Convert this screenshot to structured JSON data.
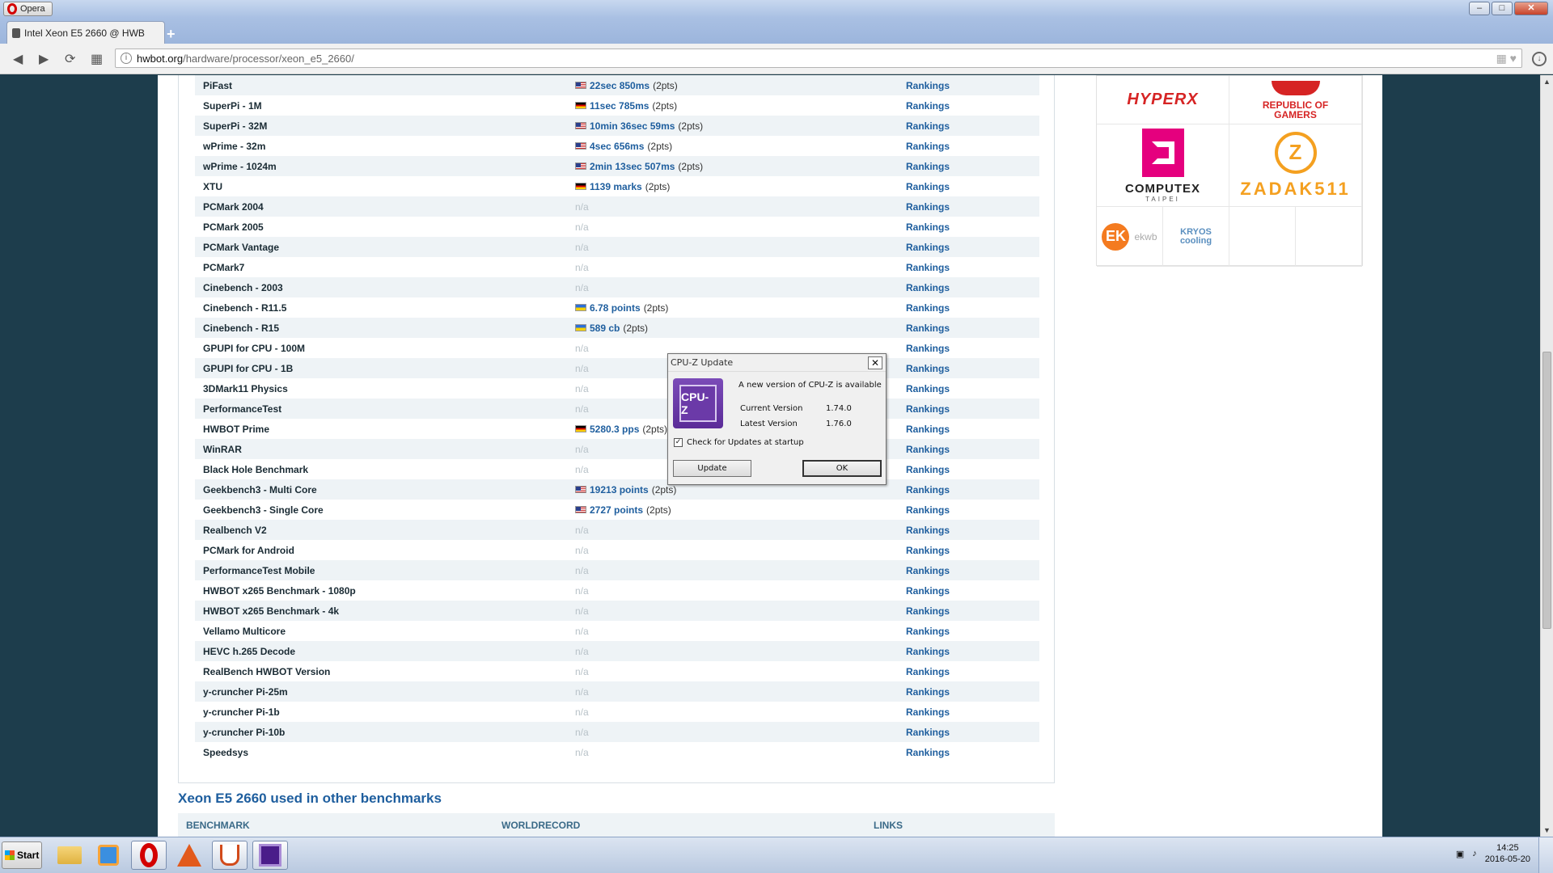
{
  "window": {
    "app_menu_label": "Opera",
    "minimize": "–",
    "maximize": "□",
    "close": "✕"
  },
  "tab": {
    "title": "Intel Xeon E5 2660 @ HWB",
    "new_tab": "+"
  },
  "address_bar": {
    "url_host": "hwbot.org",
    "url_path": "/hardware/processor/xeon_e5_2660/"
  },
  "benchmarks": [
    {
      "name": "PiFast",
      "flag": "us",
      "value": "22sec 850ms",
      "pts": "(2pts)",
      "link": "Rankings"
    },
    {
      "name": "SuperPi - 1M",
      "flag": "de",
      "value": "11sec 785ms",
      "pts": "(2pts)",
      "link": "Rankings"
    },
    {
      "name": "SuperPi - 32M",
      "flag": "us",
      "value": "10min 36sec 59ms",
      "pts": "(2pts)",
      "link": "Rankings"
    },
    {
      "name": "wPrime - 32m",
      "flag": "us",
      "value": "4sec 656ms",
      "pts": "(2pts)",
      "link": "Rankings"
    },
    {
      "name": "wPrime - 1024m",
      "flag": "us",
      "value": "2min 13sec 507ms",
      "pts": "(2pts)",
      "link": "Rankings"
    },
    {
      "name": "XTU",
      "flag": "de",
      "value": "1139 marks",
      "pts": "(2pts)",
      "link": "Rankings"
    },
    {
      "name": "PCMark 2004",
      "na": "n/a",
      "link": "Rankings"
    },
    {
      "name": "PCMark 2005",
      "na": "n/a",
      "link": "Rankings"
    },
    {
      "name": "PCMark Vantage",
      "na": "n/a",
      "link": "Rankings"
    },
    {
      "name": "PCMark7",
      "na": "n/a",
      "link": "Rankings"
    },
    {
      "name": "Cinebench - 2003",
      "na": "n/a",
      "link": "Rankings"
    },
    {
      "name": "Cinebench - R11.5",
      "flag": "ua",
      "value": "6.78 points",
      "pts": "(2pts)",
      "link": "Rankings"
    },
    {
      "name": "Cinebench - R15",
      "flag": "ua",
      "value": "589 cb",
      "pts": "(2pts)",
      "link": "Rankings"
    },
    {
      "name": "GPUPI for CPU - 100M",
      "na": "n/a",
      "link": "Rankings"
    },
    {
      "name": "GPUPI for CPU - 1B",
      "na": "n/a",
      "link": "Rankings"
    },
    {
      "name": "3DMark11 Physics",
      "na": "n/a",
      "link": "Rankings"
    },
    {
      "name": "PerformanceTest",
      "na": "n/a",
      "link": "Rankings"
    },
    {
      "name": "HWBOT Prime",
      "flag": "de",
      "value": "5280.3 pps",
      "pts": "(2pts)",
      "link": "Rankings"
    },
    {
      "name": "WinRAR",
      "na": "n/a",
      "link": "Rankings"
    },
    {
      "name": "Black Hole Benchmark",
      "na": "n/a",
      "link": "Rankings"
    },
    {
      "name": "Geekbench3 - Multi Core",
      "flag": "us",
      "value": "19213 points",
      "pts": "(2pts)",
      "link": "Rankings"
    },
    {
      "name": "Geekbench3 - Single Core",
      "flag": "us",
      "value": "2727 points",
      "pts": "(2pts)",
      "link": "Rankings"
    },
    {
      "name": "Realbench V2",
      "na": "n/a",
      "link": "Rankings"
    },
    {
      "name": "PCMark for Android",
      "na": "n/a",
      "link": "Rankings"
    },
    {
      "name": "PerformanceTest Mobile",
      "na": "n/a",
      "link": "Rankings"
    },
    {
      "name": "HWBOT x265 Benchmark - 1080p",
      "na": "n/a",
      "link": "Rankings"
    },
    {
      "name": "HWBOT x265 Benchmark - 4k",
      "na": "n/a",
      "link": "Rankings"
    },
    {
      "name": "Vellamo Multicore",
      "na": "n/a",
      "link": "Rankings"
    },
    {
      "name": "HEVC h.265 Decode",
      "na": "n/a",
      "link": "Rankings"
    },
    {
      "name": "RealBench HWBOT Version",
      "na": "n/a",
      "link": "Rankings"
    },
    {
      "name": "y-cruncher Pi-25m",
      "na": "n/a",
      "link": "Rankings"
    },
    {
      "name": "y-cruncher Pi-1b",
      "na": "n/a",
      "link": "Rankings"
    },
    {
      "name": "y-cruncher Pi-10b",
      "na": "n/a",
      "link": "Rankings"
    },
    {
      "name": "Speedsys",
      "na": "n/a",
      "link": "Rankings"
    }
  ],
  "other_section": {
    "title": "Xeon E5 2660 used in other benchmarks",
    "col_benchmark": "BENCHMARK",
    "col_worldrecord": "WORLDRECORD",
    "col_links": "LINKS"
  },
  "sponsors": {
    "hyperx": "HYPERX",
    "rog_line1": "REPUBLIC OF",
    "rog_line2": "GAMERS",
    "computex": "COMPUTEX",
    "computex_sub": "TAIPEI",
    "zadak_mark": "Z",
    "zadak": "ZADAK511",
    "ekwb_mark": "EK",
    "ekwb": "ekwb",
    "kryo_line1": "KRYOS",
    "kryo_line2": "cooling"
  },
  "dialog": {
    "title": "CPU-Z Update",
    "icon_label": "CPU-Z",
    "message": "A new version of CPU-Z is available",
    "current_label": "Current Version",
    "current_value": "1.74.0",
    "latest_label": "Latest Version",
    "latest_value": "1.76.0",
    "checkbox_label": "Check for Updates at startup",
    "checkbox_checked": true,
    "update_button": "Update",
    "ok_button": "OK"
  },
  "taskbar": {
    "start_label": "Start",
    "time": "14:25",
    "date": "2016-05-20"
  }
}
